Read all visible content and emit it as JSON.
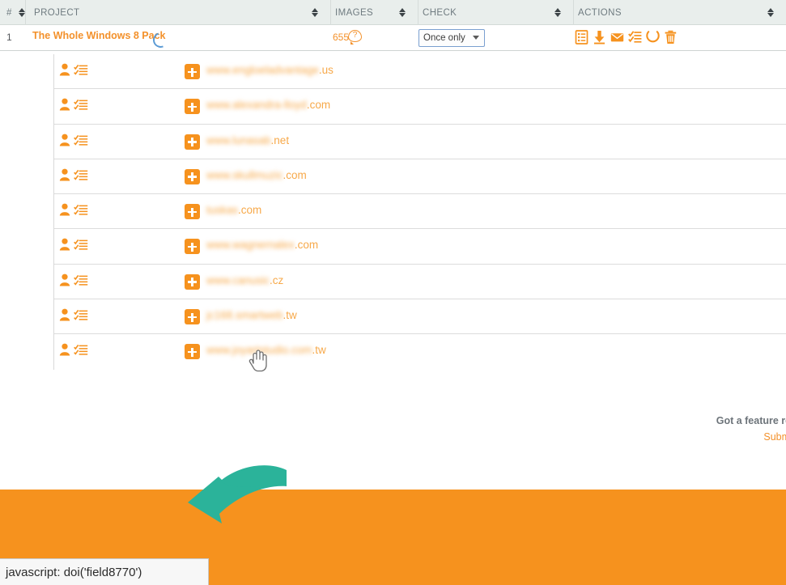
{
  "table": {
    "headers": [
      {
        "label": "#",
        "sortable": true
      },
      {
        "label": "PROJECT",
        "sortable": true
      },
      {
        "label": "IMAGES",
        "sortable": true
      },
      {
        "label": "CHECK",
        "sortable": true
      },
      {
        "label": "ACTIONS",
        "sortable": true
      }
    ],
    "project_row": {
      "index": "1",
      "name": "The Whole Windows 8 Pack",
      "loading": true,
      "images_count": "655",
      "images_help": "?",
      "check_value": "Once only",
      "check_options": [
        "Once only"
      ],
      "actions": [
        {
          "name": "report-icon",
          "title": "Report"
        },
        {
          "name": "download-icon",
          "title": "Download"
        },
        {
          "name": "email-icon",
          "title": "Email"
        },
        {
          "name": "checklist-icon",
          "title": "Checklist"
        },
        {
          "name": "refresh-icon",
          "title": "Refresh"
        },
        {
          "name": "trash-icon",
          "title": "Delete"
        }
      ]
    },
    "url_rows": [
      {
        "blurred": "www.engloeladvantage",
        "tld": ".us"
      },
      {
        "blurred": "www.alexandra-lloyd",
        "tld": ".com"
      },
      {
        "blurred": "www.lunasab",
        "tld": ".net"
      },
      {
        "blurred": "www.skullmuzic",
        "tld": ".com"
      },
      {
        "blurred": "tuskas",
        "tld": ".com"
      },
      {
        "blurred": "www.wagnernalex",
        "tld": ".com"
      },
      {
        "blurred": "www.canusic",
        "tld": ".cz"
      },
      {
        "blurred": "jc168.smartweb",
        "tld": ".tw"
      },
      {
        "blurred": "www.joyartstudio.com",
        "tld": ".tw"
      }
    ]
  },
  "promo": {
    "line1": "Got a feature request or id",
    "line2": "Submit and vote on fe"
  },
  "status_bar": {
    "text": "javascript: doi('field8770')"
  },
  "colors": {
    "brand_orange": "#f6921e",
    "link_orange": "#f3912b",
    "arrow_teal": "#2bb39a",
    "header_bg": "#e9eeec",
    "select_border": "#7a9fd0"
  }
}
